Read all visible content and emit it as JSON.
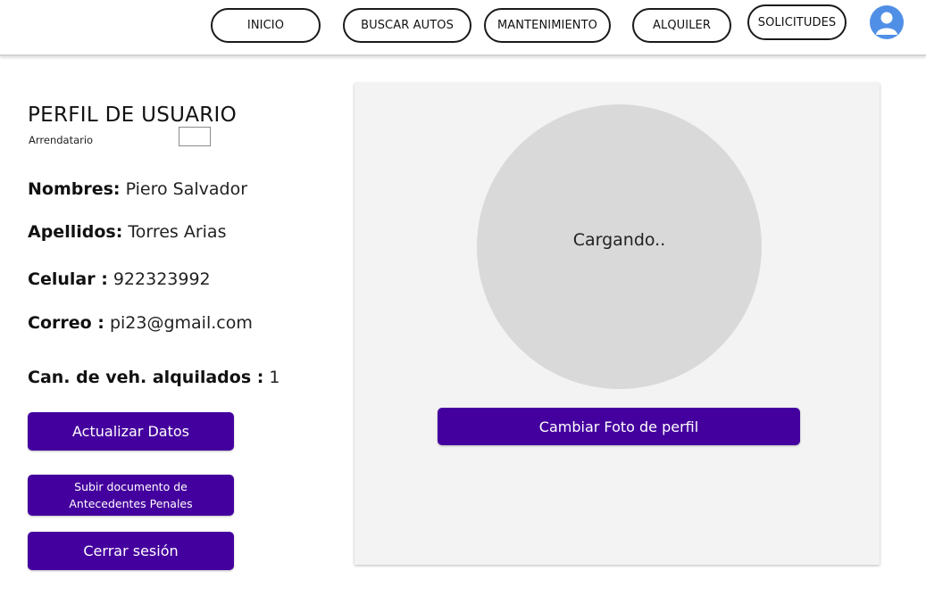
{
  "nav": {
    "items": [
      {
        "label": "INICIO"
      },
      {
        "label": "BUSCAR AUTOS"
      },
      {
        "label": "MANTENIMIENTO"
      },
      {
        "label": "ALQUILER"
      },
      {
        "label": "SOLICITUDES"
      }
    ],
    "avatar_icon": "user-avatar-icon"
  },
  "profile": {
    "title": "PERFIL DE USUARIO",
    "role": "Arrendatario",
    "fields": {
      "nombres": {
        "label": "Nombres:",
        "value": "Piero Salvador"
      },
      "apellidos": {
        "label": "Apellidos:",
        "value": "Torres Arias"
      },
      "celular": {
        "label": "Celular :",
        "value": "922323992"
      },
      "correo": {
        "label": "Correo :",
        "value": "pi23@gmail.com"
      },
      "vehiculos": {
        "label": "Can. de veh. alquilados :",
        "value": "1"
      }
    },
    "buttons": {
      "update": "Actualizar Datos",
      "upload_line1": "Subir documento de",
      "upload_line2": "Antecedentes Penales",
      "logout": "Cerrar sesión"
    }
  },
  "photo": {
    "status": "Cargando..",
    "change_button": "Cambiar Foto de perfil"
  },
  "colors": {
    "primary": "#44009e",
    "panel_bg": "#f3f3f3",
    "placeholder": "#d9d9d9",
    "avatar": "#4f8fe6"
  }
}
